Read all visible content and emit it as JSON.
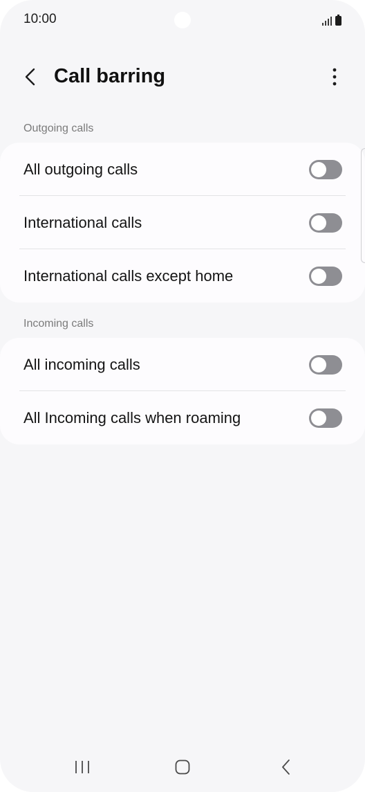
{
  "status_bar": {
    "time": "10:00"
  },
  "header": {
    "title": "Call barring",
    "back_icon": "chevron-left-icon",
    "more_icon": "more-vertical-icon"
  },
  "sections": [
    {
      "label": "Outgoing calls",
      "items": [
        {
          "label": "All outgoing calls",
          "enabled": false
        },
        {
          "label": "International calls",
          "enabled": false
        },
        {
          "label": "International calls except home",
          "enabled": false
        }
      ]
    },
    {
      "label": "Incoming calls",
      "items": [
        {
          "label": "All incoming calls",
          "enabled": false
        },
        {
          "label": "All Incoming calls when roaming",
          "enabled": false
        }
      ]
    }
  ],
  "nav_bar": {
    "recents_icon": "recents-icon",
    "home_icon": "home-icon",
    "back_icon": "back-icon"
  },
  "colors": {
    "background": "#f6f6f8",
    "card": "#fdfcfe",
    "toggle_off": "#8e8e93",
    "text_primary": "#141414",
    "text_secondary": "#7a7a7a"
  }
}
